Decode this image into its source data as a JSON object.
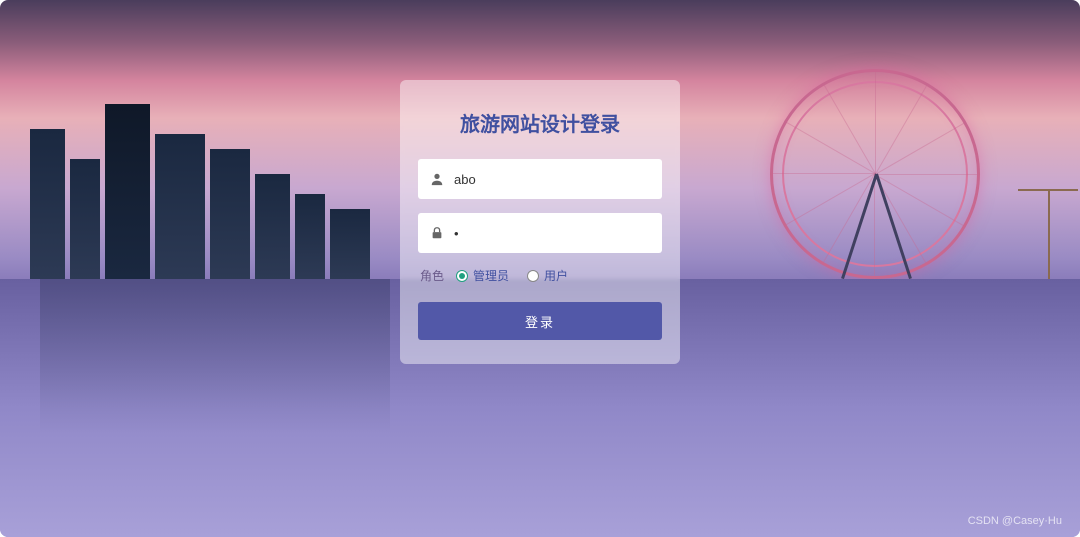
{
  "login": {
    "title": "旅游网站设计登录",
    "username_value": "abo",
    "username_placeholder": "",
    "password_value": "•",
    "password_placeholder": "",
    "role_label": "角色",
    "roles": {
      "admin": "管理员",
      "user": "用户"
    },
    "selected_role": "admin",
    "login_button": "登录"
  },
  "watermark": "CSDN @Casey·Hu",
  "colors": {
    "primary": "#5258a8",
    "accent": "#20a080",
    "title": "#4050a0"
  }
}
